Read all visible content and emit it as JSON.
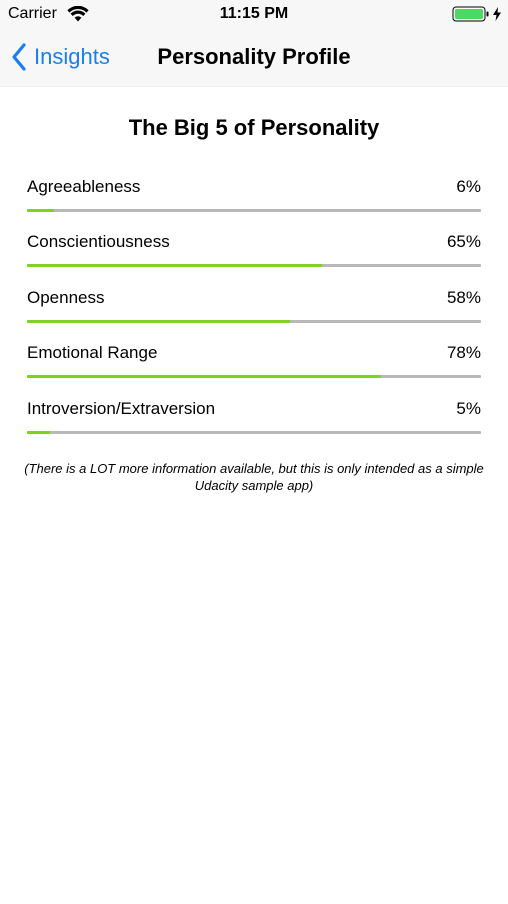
{
  "status_bar": {
    "carrier": "Carrier",
    "time": "11:15 PM",
    "battery_level": 1.0,
    "icons": [
      "wifi-icon",
      "battery-icon",
      "charging-icon"
    ]
  },
  "nav": {
    "back_label": "Insights",
    "title": "Personality Profile",
    "accent_color": "#1a7ef2"
  },
  "profile": {
    "title": "The Big 5 of Personality",
    "fill_color": "#7ed321",
    "track_color": "#b8b8b8",
    "traits": [
      {
        "name": "Agreeableness",
        "value_label": "6%",
        "value": 0.06
      },
      {
        "name": "Conscientiousness",
        "value_label": "65%",
        "value": 0.65
      },
      {
        "name": "Openness",
        "value_label": "58%",
        "value": 0.58
      },
      {
        "name": "Emotional Range",
        "value_label": "78%",
        "value": 0.78
      },
      {
        "name": "Introversion/Extraversion",
        "value_label": "5%",
        "value": 0.05
      }
    ],
    "footnote": "(There is a LOT more information available, but this is only intended as a simple Udacity sample app)"
  }
}
